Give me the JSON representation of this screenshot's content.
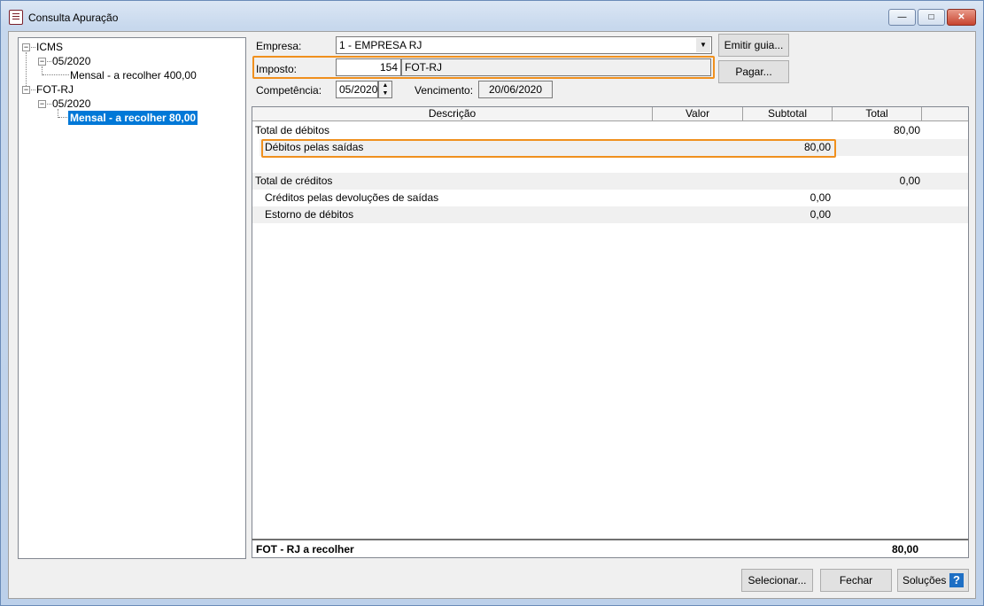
{
  "window": {
    "title": "Consulta Apuração",
    "minimize": "—",
    "maximize": "□",
    "close": "✕"
  },
  "tree": {
    "icms": "ICMS",
    "icms_period": "05/2020",
    "icms_leaf": "Mensal - a recolher 400,00",
    "fot": "FOT-RJ",
    "fot_period": "05/2020",
    "fot_leaf": "Mensal - a recolher 80,00",
    "expander_symbol": "−"
  },
  "form": {
    "empresa_label": "Empresa:",
    "empresa_value": "1 - EMPRESA RJ",
    "imposto_label": "Imposto:",
    "imposto_code": "154",
    "imposto_name": "FOT-RJ",
    "competencia_label": "Competência:",
    "competencia_value": "05/2020",
    "vencimento_label": "Vencimento:",
    "vencimento_value": "20/06/2020"
  },
  "buttons": {
    "emitir_guia": "Emitir guia...",
    "pagar": "Pagar...",
    "selecionar": "Selecionar...",
    "fechar": "Fechar",
    "solucoes": "Soluções",
    "help": "?"
  },
  "grid": {
    "columns": [
      "Descrição",
      "Valor",
      "Subtotal",
      "Total"
    ],
    "rows": [
      {
        "descricao": "Total de débitos",
        "valor": "",
        "subtotal": "",
        "total": "80,00"
      },
      {
        "descricao": "Débitos pelas saídas",
        "valor": "",
        "subtotal": "80,00",
        "total": ""
      },
      {
        "descricao": "",
        "valor": "",
        "subtotal": "",
        "total": ""
      },
      {
        "descricao": "Total de créditos",
        "valor": "",
        "subtotal": "",
        "total": "0,00"
      },
      {
        "descricao": "Créditos pelas devoluções de saídas",
        "valor": "",
        "subtotal": "0,00",
        "total": ""
      },
      {
        "descricao": "Estorno de débitos",
        "valor": "",
        "subtotal": "0,00",
        "total": ""
      }
    ],
    "footer_label": "FOT - RJ a recolher",
    "footer_value": "80,00"
  },
  "colors": {
    "highlight": "#f0901e",
    "selection": "#0078d7"
  }
}
